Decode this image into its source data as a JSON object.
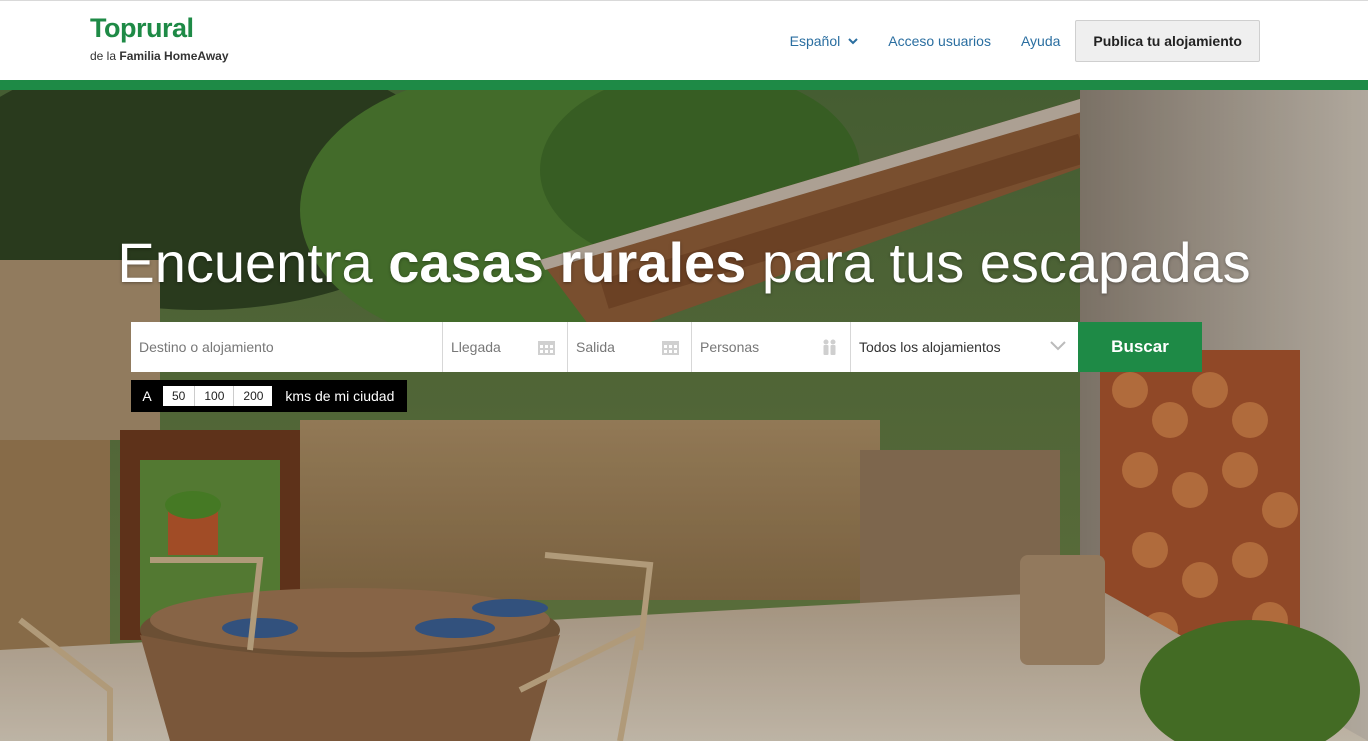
{
  "header": {
    "logo_main": "Toprural",
    "logo_sub_prefix": "de la ",
    "logo_sub_brand": "Familia HomeAway",
    "nav": {
      "language": "Español",
      "login": "Acceso usuarios",
      "help": "Ayuda",
      "publish": "Publica tu alojamiento"
    }
  },
  "hero": {
    "title_start": "Encuentra ",
    "title_bold": "casas rurales",
    "title_end": " para tus escapadas"
  },
  "search": {
    "destination_placeholder": "Destino o alojamiento",
    "arrival_placeholder": "Llegada",
    "departure_placeholder": "Salida",
    "people_placeholder": "Personas",
    "type_selected": "Todos los alojamientos",
    "button": "Buscar"
  },
  "radius": {
    "prefix": "A",
    "options": [
      "50",
      "100",
      "200"
    ],
    "suffix": "kms de mi ciudad"
  },
  "colors": {
    "brand_green": "#1e8a46",
    "link_blue": "#2a6ea0"
  },
  "icons": [
    "chevron-down-icon",
    "calendar-icon",
    "people-icon"
  ]
}
